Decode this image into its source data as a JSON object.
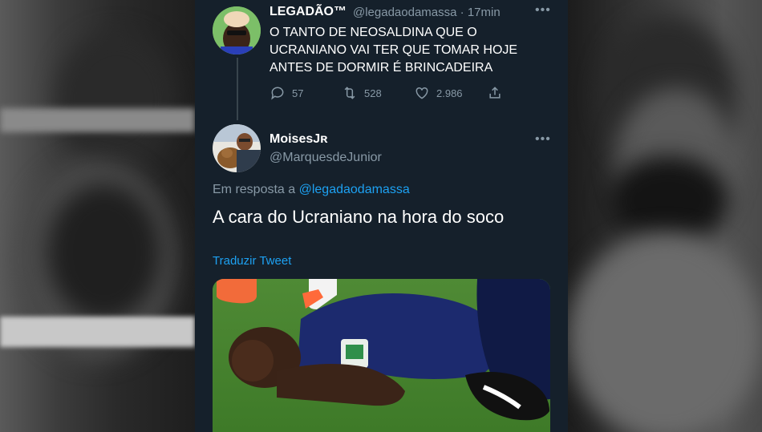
{
  "tweet1": {
    "display_name": "LEGADÃO™",
    "handle": "@legadaodamassa",
    "separator": "·",
    "time": "17min",
    "text_lines": [
      "O TANTO DE NEOSALDINA QUE O",
      "UCRANIANO VAI TER QUE TOMAR HOJE",
      "ANTES DE DORMIR É BRINCADEIRA"
    ],
    "replies": "57",
    "retweets": "528",
    "likes": "2.986"
  },
  "tweet2": {
    "display_name": "MoisesJʀ",
    "handle": "@MarquesdeJunior",
    "reply_prefix": "Em resposta a",
    "reply_to": "@legadaodamassa",
    "text": "A cara do Ucraniano na hora do soco",
    "translate": "Traduzir Tweet"
  },
  "icons": {
    "more": "more-icon",
    "reply": "reply-icon",
    "retweet": "retweet-icon",
    "like": "heart-icon",
    "share": "share-icon"
  },
  "colors": {
    "background": "#15202b",
    "link": "#1da1f2",
    "muted": "#8899a6",
    "text": "#ffffff"
  }
}
